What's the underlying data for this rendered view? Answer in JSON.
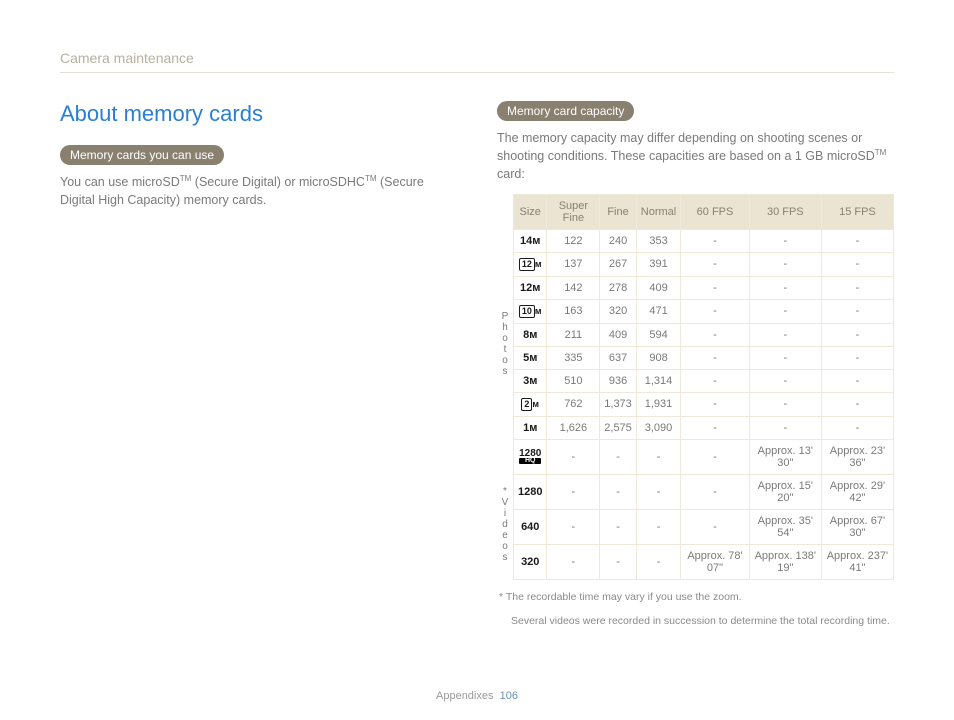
{
  "breadcrumb": "Camera maintenance",
  "section_title": "About memory cards",
  "left": {
    "pill": "Memory cards you can use",
    "text_pre": "You can use microSD",
    "text_mid": " (Secure Digital) or microSDHC",
    "text_post": " (Secure Digital High Capacity) memory cards.",
    "tm": "TM"
  },
  "right": {
    "pill": "Memory card capacity",
    "text1": "The memory capacity may differ depending on shooting scenes or shooting conditions. These capacities are based on a 1 GB microSD",
    "tm": "TM",
    "text2": " card:"
  },
  "table": {
    "headers": [
      "Size",
      "Super Fine",
      "Fine",
      "Normal",
      "60 FPS",
      "30 FPS",
      "15 FPS"
    ],
    "photos_label": "Photos",
    "videos_label": "*Videos",
    "photos": [
      {
        "size": "14ᴍ",
        "sf": "122",
        "f": "240",
        "n": "353",
        "c60": "-",
        "c30": "-",
        "c15": "-"
      },
      {
        "size": "⬚12",
        "boxed": true,
        "sf": "137",
        "f": "267",
        "n": "391",
        "c60": "-",
        "c30": "-",
        "c15": "-"
      },
      {
        "size": "12ᴍ",
        "sf": "142",
        "f": "278",
        "n": "409",
        "c60": "-",
        "c30": "-",
        "c15": "-"
      },
      {
        "size": "⬚10",
        "boxed": true,
        "sf": "163",
        "f": "320",
        "n": "471",
        "c60": "-",
        "c30": "-",
        "c15": "-"
      },
      {
        "size": "8ᴍ",
        "sf": "211",
        "f": "409",
        "n": "594",
        "c60": "-",
        "c30": "-",
        "c15": "-"
      },
      {
        "size": "5ᴍ",
        "sf": "335",
        "f": "637",
        "n": "908",
        "c60": "-",
        "c30": "-",
        "c15": "-"
      },
      {
        "size": "3ᴍ",
        "sf": "510",
        "f": "936",
        "n": "1,314",
        "c60": "-",
        "c30": "-",
        "c15": "-"
      },
      {
        "size": "⬚2",
        "boxed": true,
        "sf": "762",
        "f": "1,373",
        "n": "1,931",
        "c60": "-",
        "c30": "-",
        "c15": "-"
      },
      {
        "size": "1ᴍ",
        "sf": "1,626",
        "f": "2,575",
        "n": "3,090",
        "c60": "-",
        "c30": "-",
        "c15": "-"
      }
    ],
    "videos": [
      {
        "size": "1280",
        "hq": true,
        "sf": "-",
        "f": "-",
        "n": "-",
        "c60": "-",
        "c30": "Approx. 13' 30\"",
        "c15": "Approx. 23' 36\""
      },
      {
        "size": "1280",
        "sf": "-",
        "f": "-",
        "n": "-",
        "c60": "-",
        "c30": "Approx. 15' 20\"",
        "c15": "Approx. 29' 42\""
      },
      {
        "size": "640",
        "sf": "-",
        "f": "-",
        "n": "-",
        "c60": "-",
        "c30": "Approx. 35' 54\"",
        "c15": "Approx. 67' 30\""
      },
      {
        "size": "320",
        "sf": "-",
        "f": "-",
        "n": "-",
        "c60": "Approx. 78' 07\"",
        "c30": "Approx. 138' 19\"",
        "c15": "Approx. 237' 41\""
      }
    ]
  },
  "footnote1": "* The recordable time may vary if you use the zoom.",
  "footnote2": "Several videos were recorded in succession to determine the total recording time.",
  "footer_label": "Appendixes",
  "page_number": "106"
}
